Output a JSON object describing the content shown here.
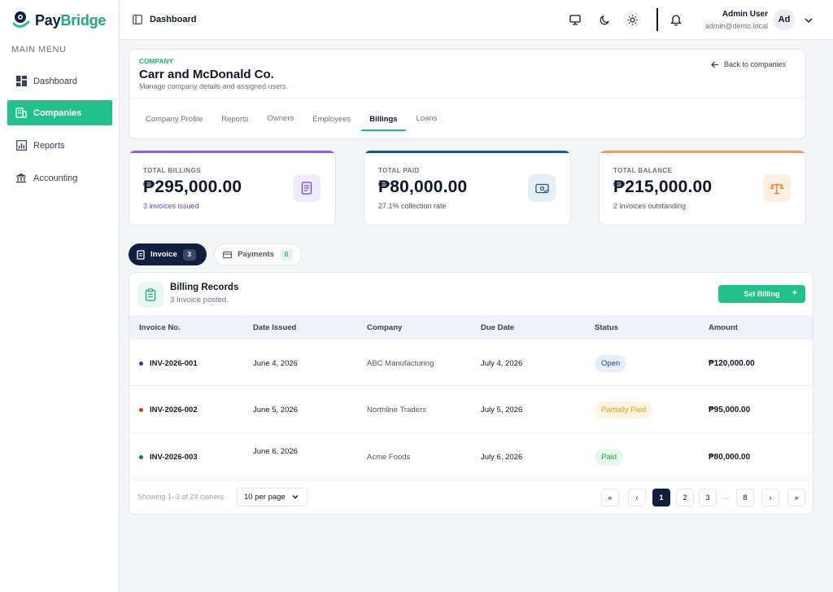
{
  "brand": {
    "name_left": "Pay",
    "name_right": "Bridge",
    "accent": "#22c08a",
    "navy": "#0f1f3d"
  },
  "sidebar": {
    "section_label": "MAIN MENU",
    "items": [
      {
        "label": "Dashboard",
        "icon": "dashboard-grid-icon"
      },
      {
        "label": "Companies",
        "icon": "building-icon",
        "active": true
      },
      {
        "label": "Reports",
        "icon": "bar-chart-icon"
      },
      {
        "label": "Accounting",
        "icon": "bank-icon"
      }
    ]
  },
  "topbar": {
    "title": "Dashboard",
    "user_name": "Admin User",
    "user_email": "admin@demo.local",
    "avatar_initials": "Ad"
  },
  "company": {
    "eyebrow": "COMPANY",
    "name": "Carr and McDonald Co.",
    "description": "Manage company details and assigned users.",
    "back_label": "Back to companies",
    "tabs": [
      "Company Profile",
      "Reports",
      "Owners",
      "Employees",
      "Billings",
      "Loans"
    ],
    "active_tab": "Billings"
  },
  "stats": [
    {
      "label": "TOTAL BILLINGS",
      "value": "₱295,000.00",
      "sub": "3 invoices issued",
      "color": "#8b5cf6"
    },
    {
      "label": "TOTAL PAID",
      "value": "₱80,000.00",
      "sub": "27.1% collection rate",
      "color": "#1e5a8c"
    },
    {
      "label": "TOTAL BALANCE",
      "value": "₱215,000.00",
      "sub": "2 invoices outstanding",
      "color": "#f59e42"
    }
  ],
  "segments": {
    "invoice": {
      "label": "Invoice",
      "count": "3"
    },
    "payments": {
      "label": "Payments",
      "count": "0"
    }
  },
  "billing": {
    "title": "Billing Records",
    "subtitle": "3 Invoice posted.",
    "set_billing_label": "Set Billing",
    "set_billing_plus": "+",
    "columns": [
      "Invoice No.",
      "Date Issued",
      "Company",
      "Due Date",
      "Status",
      "Amount"
    ],
    "rows": [
      {
        "invoice": "INV-2026-001",
        "date_issued": "June 4, 2026",
        "company": "ABC Manufacturing",
        "due_date": "July 4, 2026",
        "status": "Open",
        "amount": "₱120,000.00",
        "dot": "#1e40af"
      },
      {
        "invoice": "INV-2026-002",
        "date_issued": "June 5, 2026",
        "company": "Northline Traders",
        "due_date": "July 5, 2026",
        "status": "Partially Paid",
        "amount": "₱95,000.00",
        "dot": "#c2410c"
      },
      {
        "invoice": "INV-2026-003",
        "date_issued": "June 6, 2026",
        "company": "Acme Foods",
        "due_date": "July 6, 2026",
        "status": "Paid",
        "amount": "₱80,000.00",
        "dot": "#15803d"
      }
    ],
    "footer_text": "Showing 1–3 of 24 owners",
    "per_page": "10 per page",
    "pages": [
      "1",
      "2",
      "3",
      "8"
    ],
    "ellipsis": "...",
    "first": "«",
    "prev": "‹",
    "next": "›",
    "last": "»"
  }
}
